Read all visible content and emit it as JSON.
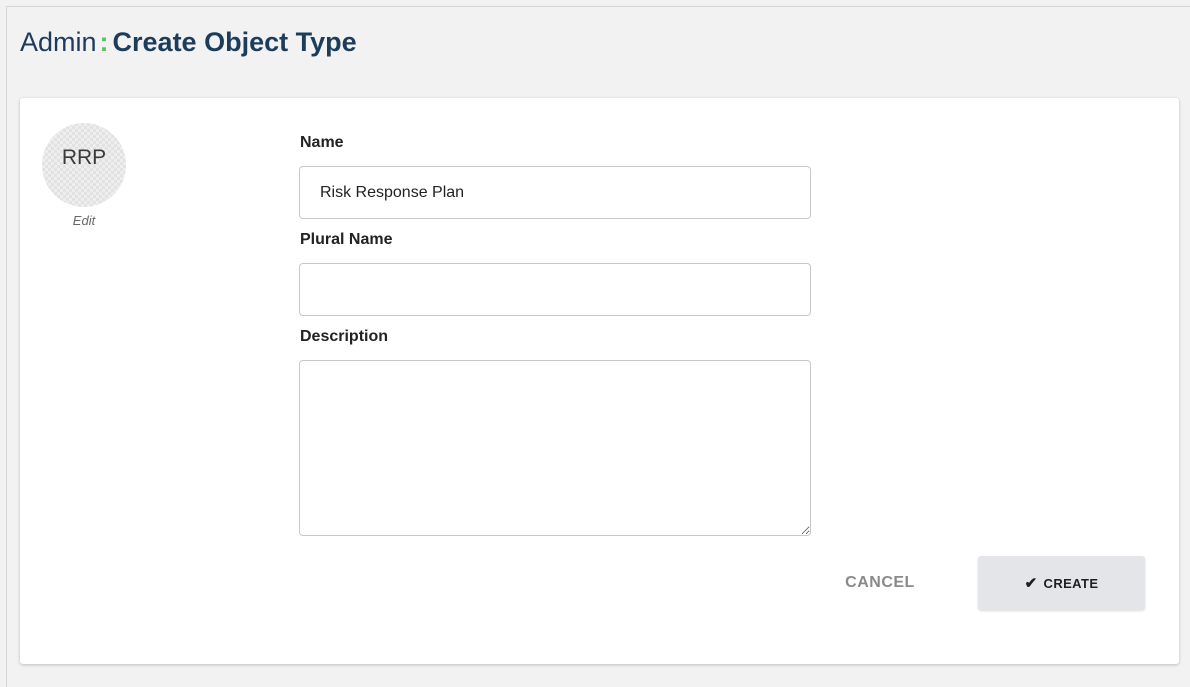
{
  "header": {
    "section": "Admin",
    "separator": ":",
    "title": "Create Object Type"
  },
  "avatar": {
    "initials": "RRP",
    "edit_label": "Edit"
  },
  "form": {
    "name": {
      "label": "Name",
      "value": "Risk Response Plan"
    },
    "plural_name": {
      "label": "Plural Name",
      "value": ""
    },
    "description": {
      "label": "Description",
      "value": ""
    }
  },
  "actions": {
    "cancel_label": "CANCEL",
    "create_label": "CREATE",
    "create_icon": "checkmark-icon"
  },
  "colors": {
    "title": "#1c3d5a",
    "separator": "#5cc35a",
    "create_button_bg": "#e3e5e8",
    "cancel_text": "#8a8a8a"
  }
}
